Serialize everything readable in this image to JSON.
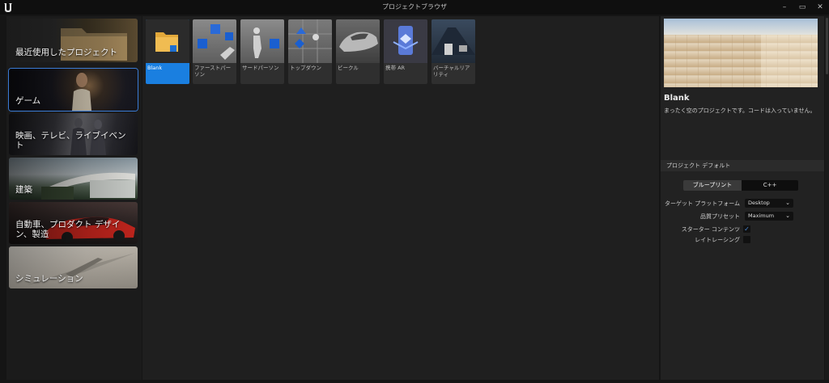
{
  "window": {
    "title": "プロジェクトブラウザ",
    "controls": {
      "minimize": "–",
      "maximize": "▭",
      "close": "✕"
    }
  },
  "categories": [
    {
      "label": "最近使用したプロジェクト",
      "icon": "folder-icon"
    },
    {
      "label": "ゲーム",
      "icon": "game-thumbnail"
    },
    {
      "label": "映画、テレビ、ライブイベント",
      "icon": "film-thumbnail"
    },
    {
      "label": "建築",
      "icon": "architecture-thumbnail"
    },
    {
      "label": "自動車、プロダクト デザイン、製造",
      "icon": "car-thumbnail"
    },
    {
      "label": "シミュレーション",
      "icon": "aircraft-thumbnail"
    }
  ],
  "templates": [
    {
      "label": "Blank"
    },
    {
      "label": "ファーストパーソン"
    },
    {
      "label": "サードパーソン"
    },
    {
      "label": "トップダウン"
    },
    {
      "label": "ビークル"
    },
    {
      "label": "携帯 AR"
    },
    {
      "label": "バーチャルリアリティ"
    }
  ],
  "details": {
    "title": "Blank",
    "description": "まったく空のプロジェクトです。コードは入っていません。",
    "section_header": "プロジェクト デフォルト",
    "mode_blueprint": "ブループリント",
    "mode_cpp": "C++",
    "target_platform_label": "ターゲット プラットフォーム",
    "target_platform_value": "Desktop",
    "quality_label": "品質プリセット",
    "quality_value": "Maximum",
    "starter_label": "スターター コンテンツ",
    "starter_checked": "✓",
    "raytracing_label": "レイトレーシング"
  },
  "colors": {
    "accent": "#1a7fe0",
    "selected_outline": "#3a7bd5"
  }
}
